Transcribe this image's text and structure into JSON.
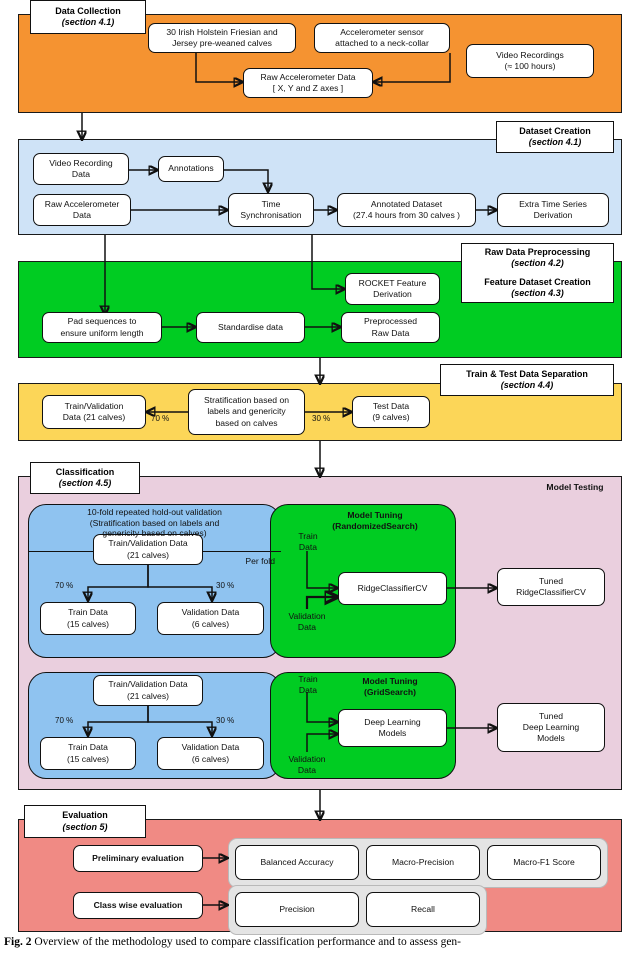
{
  "figure": {
    "caption_label": "Fig. 2",
    "caption_text": "Overview of the methodology used to compare classification performance and to assess gen-"
  },
  "colors": {
    "data_collection": "#f59331",
    "dataset_creation": "#cfe3f7",
    "preprocessing": "#00cc22",
    "train_test_split": "#fcd658",
    "classification": "#eacfde",
    "evaluation": "#f08a84",
    "fold_panel": "#8fc3f0",
    "tuning_panel": "#00cc22",
    "metric_group": "#e4e4e4",
    "node_fill": "#ffffff",
    "stroke": "#111111"
  },
  "stages": {
    "data_collection": {
      "title": "Data Collection",
      "section": "(section 4.1)",
      "nodes": {
        "calves": "30 Irish Holstein Friesian and\nJersey pre-weaned calves",
        "calves_l1": "30 Irish Holstein Friesian and",
        "calves_l2": "Jersey pre-weaned calves",
        "sensor_l1": "Accelerometer sensor",
        "sensor_l2": "attached to a neck-collar",
        "raw_accel_l1": "Raw Accelerometer Data",
        "raw_accel_l2": "[ X, Y and Z axes ]",
        "video_l1": "Video Recordings",
        "video_l2": "(≈ 100 hours)"
      }
    },
    "dataset_creation": {
      "title": "Dataset Creation",
      "section": "(section 4.1)",
      "nodes": {
        "video_data_l1": "Video Recording",
        "video_data_l2": "Data",
        "annotations": "Annotations",
        "raw_accel_l1": "Raw Accelerometer",
        "raw_accel_l2": "Data",
        "time_sync_l1": "Time",
        "time_sync_l2": "Synchronisation",
        "annotated_l1": "Annotated Dataset",
        "annotated_l2": "(27.4 hours from 30 calves )",
        "extra_ts_l1": "Extra Time Series",
        "extra_ts_l2": "Derivation"
      }
    },
    "preprocessing": {
      "title_1": "Raw Data Preprocessing",
      "section_1": "(section 4.2)",
      "title_2": "Feature Dataset Creation",
      "section_2": "(section 4.3)",
      "nodes": {
        "rocket_l1": "ROCKET Feature",
        "rocket_l2": "Derivation",
        "pad_l1": "Pad sequences to",
        "pad_l2": "ensure uniform length",
        "standardise": "Standardise data",
        "preprocessed_l1": "Preprocessed",
        "preprocessed_l2": "Raw Data"
      }
    },
    "train_test_split": {
      "title": "Train & Test Data Separation",
      "section": "(section 4.4)",
      "nodes": {
        "train_val_l1": "Train/Validation",
        "train_val_l2": "Data (21 calves)",
        "strat_l1": "Stratification based on",
        "strat_l2": "labels and genericity",
        "strat_l3": "based on calves",
        "test_l1": "Test Data",
        "test_l2": "(9 calves)"
      },
      "edge_labels": {
        "left": "70 %",
        "right": "30 %"
      }
    },
    "classification": {
      "title": "Classification",
      "section": "(section 4.5)",
      "model_testing_label": "Model Testing",
      "fold_header_l1": "10-fold repeated hold-out validation",
      "fold_header_l2": "(Stratification based on labels and",
      "fold_header_l3": "genericity based on calves)",
      "per_fold_label": "Per fold",
      "rows": [
        {
          "train_val_l1": "Train/Validation Data",
          "train_val_l2": "(21 calves)",
          "pct_left": "70 %",
          "pct_right": "30 %",
          "train_l1": "Train Data",
          "train_l2": "(15 calves)",
          "val_l1": "Validation Data",
          "val_l2": "(6 calves)",
          "tuning_title": "Model Tuning",
          "tuning_method": "(RandomizedSearch)",
          "in_train_l1": "Train",
          "in_train_l2": "Data",
          "in_val_l1": "Validation",
          "in_val_l2": "Data",
          "model_l1": "RidgeClassifierCV",
          "model_l2": "",
          "tuned_l1": "Tuned",
          "tuned_l2": "RidgeClassifierCV",
          "tuned_l3": ""
        },
        {
          "train_val_l1": "Train/Validation Data",
          "train_val_l2": "(21 calves)",
          "pct_left": "70 %",
          "pct_right": "30 %",
          "train_l1": "Train Data",
          "train_l2": "(15 calves)",
          "val_l1": "Validation Data",
          "val_l2": "(6 calves)",
          "tuning_title": "Model Tuning",
          "tuning_method": "(GridSearch)",
          "in_train_l1": "Train",
          "in_train_l2": "Data",
          "in_val_l1": "Validation",
          "in_val_l2": "Data",
          "model_l1": "Deep Learning",
          "model_l2": "Models",
          "tuned_l1": "Tuned",
          "tuned_l2": "Deep Learning",
          "tuned_l3": "Models"
        }
      ]
    },
    "evaluation": {
      "title": "Evaluation",
      "section": "(section 5)",
      "preliminary_label": "Preliminary evaluation",
      "classwise_label": "Class wise evaluation",
      "preliminary_metrics": [
        "Balanced Accuracy",
        "Macro-Precision",
        "Macro-F1 Score"
      ],
      "classwise_metrics": [
        "Precision",
        "Recall"
      ]
    }
  }
}
